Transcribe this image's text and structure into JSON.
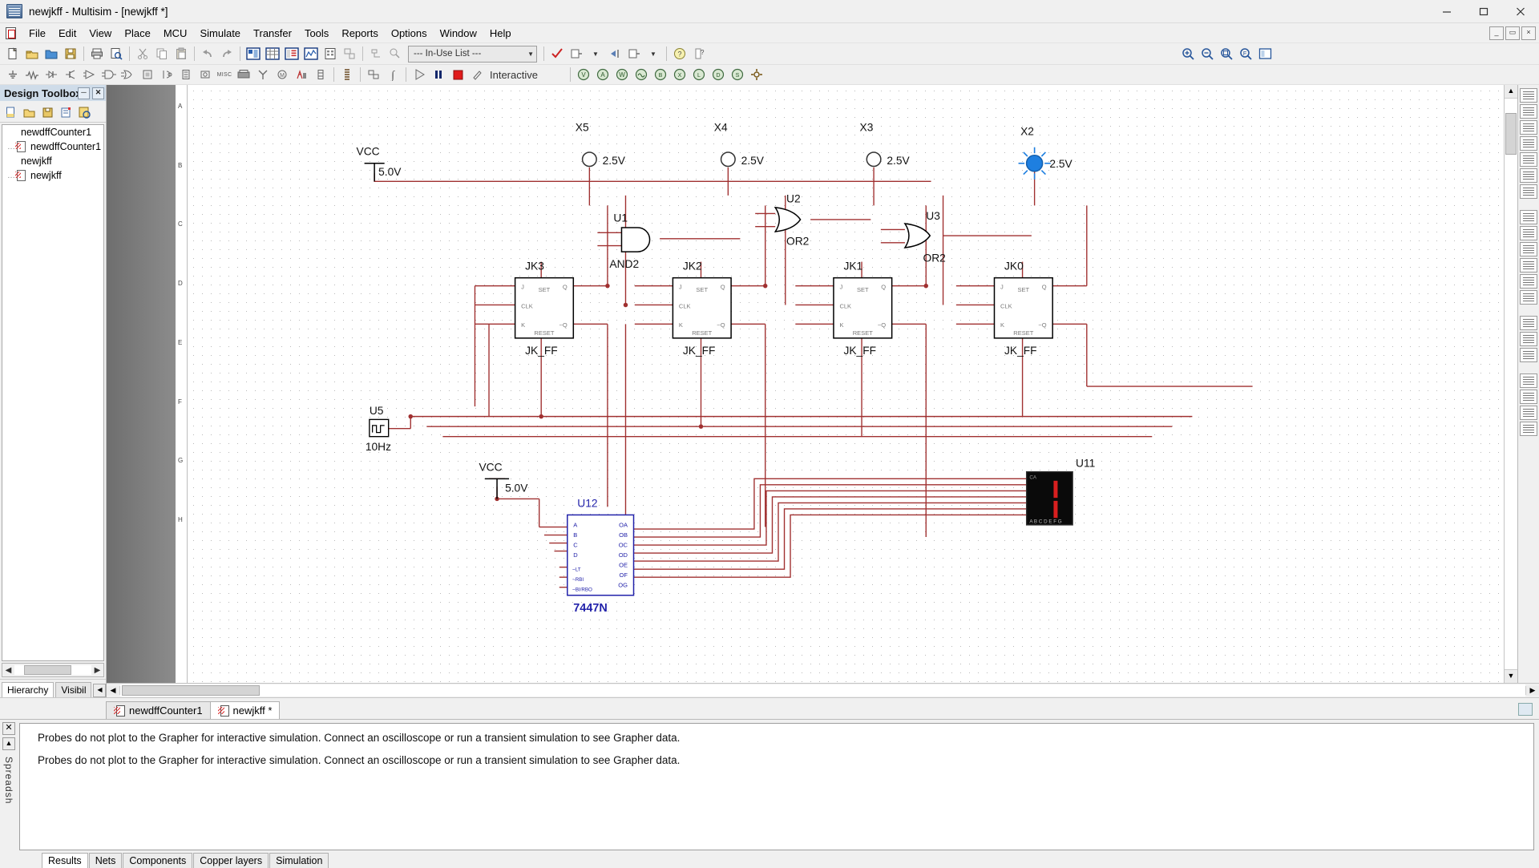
{
  "window": {
    "title": "newjkff - Multisim - [newjkff *]",
    "minimize": "minimize-icon",
    "maximize": "maximize-icon",
    "close": "close-icon"
  },
  "menu": {
    "items": [
      "File",
      "Edit",
      "View",
      "Place",
      "MCU",
      "Simulate",
      "Transfer",
      "Tools",
      "Reports",
      "Options",
      "Window",
      "Help"
    ],
    "mdi_buttons": [
      "_",
      "▭",
      "×"
    ]
  },
  "toolbar": {
    "in_use_list": "--- In-Use List ---",
    "simulation_mode": "Interactive",
    "run_label": "run-button",
    "pause_label": "pause-button",
    "stop_label": "stop-button"
  },
  "design_toolbox": {
    "title": "Design Toolbox",
    "tree": [
      {
        "label": "newdffCounter1",
        "indent": 0,
        "icon": false
      },
      {
        "label": "newdffCounter1",
        "indent": 1,
        "icon": true
      },
      {
        "label": "newjkff",
        "indent": 0,
        "icon": false
      },
      {
        "label": "newjkff",
        "indent": 1,
        "icon": true
      }
    ],
    "tabs": [
      {
        "label": "Hierarchy",
        "active": true
      },
      {
        "label": "Visibil",
        "active": false
      }
    ]
  },
  "sheet_tabs": [
    {
      "label": "newdffCounter1",
      "active": false
    },
    {
      "label": "newjkff *",
      "active": true
    }
  ],
  "spreadsheet": {
    "side_label": "Spreadsh",
    "messages": [
      "Probes do not plot to the Grapher for interactive simulation. Connect an oscilloscope or run a transient simulation to see Grapher data.",
      "Probes do not plot to the Grapher for interactive simulation. Connect an oscilloscope or run a transient simulation to see Grapher data."
    ],
    "tabs": [
      {
        "label": "Results",
        "active": true
      },
      {
        "label": "Nets",
        "active": false
      },
      {
        "label": "Components",
        "active": false
      },
      {
        "label": "Copper layers",
        "active": false
      },
      {
        "label": "Simulation",
        "active": false
      }
    ]
  },
  "ruler": {
    "rows": [
      "A",
      "B",
      "C",
      "D",
      "E",
      "F",
      "G",
      "H"
    ]
  },
  "schematic": {
    "wire_color": "#a03030",
    "probe_on_color": "#1e7fe0",
    "probe_off_color": "#ffffff",
    "probes": [
      {
        "ref": "X5",
        "value": "2.5V",
        "state": "off"
      },
      {
        "ref": "X4",
        "value": "2.5V",
        "state": "off"
      },
      {
        "ref": "X3",
        "value": "2.5V",
        "state": "off"
      },
      {
        "ref": "X2",
        "value": "2.5V",
        "state": "on"
      }
    ],
    "power_sources": [
      {
        "ref": "VCC",
        "value": "5.0V"
      },
      {
        "ref": "VCC",
        "value": "5.0V"
      }
    ],
    "clock": {
      "ref": "U5",
      "value": "10Hz"
    },
    "gates": [
      {
        "ref": "U1",
        "type": "AND2"
      },
      {
        "ref": "U2",
        "type": "OR2"
      },
      {
        "ref": "U3",
        "type": "OR2"
      }
    ],
    "flipflops": [
      {
        "ref": "JK3",
        "part": "JK_FF",
        "pins": [
          "SET",
          "J",
          "CLK",
          "K",
          "RESET",
          "Q",
          "~Q"
        ]
      },
      {
        "ref": "JK2",
        "part": "JK_FF",
        "pins": [
          "SET",
          "J",
          "CLK",
          "K",
          "RESET",
          "Q",
          "~Q"
        ]
      },
      {
        "ref": "JK1",
        "part": "JK_FF",
        "pins": [
          "SET",
          "J",
          "CLK",
          "K",
          "RESET",
          "Q",
          "~Q"
        ]
      },
      {
        "ref": "JK0",
        "part": "JK_FF",
        "pins": [
          "SET",
          "J",
          "CLK",
          "K",
          "RESET",
          "Q",
          "~Q"
        ]
      }
    ],
    "decoder": {
      "ref": "U12",
      "part": "7447N",
      "inputs": [
        "A",
        "B",
        "C",
        "D",
        "~LT",
        "~RBI",
        "~BI/RBO"
      ],
      "outputs": [
        "OA",
        "OB",
        "OC",
        "OD",
        "OE",
        "OF",
        "OG"
      ]
    },
    "display": {
      "ref": "U11",
      "segment_labels": "A B C D E F G",
      "digit": "1"
    }
  }
}
